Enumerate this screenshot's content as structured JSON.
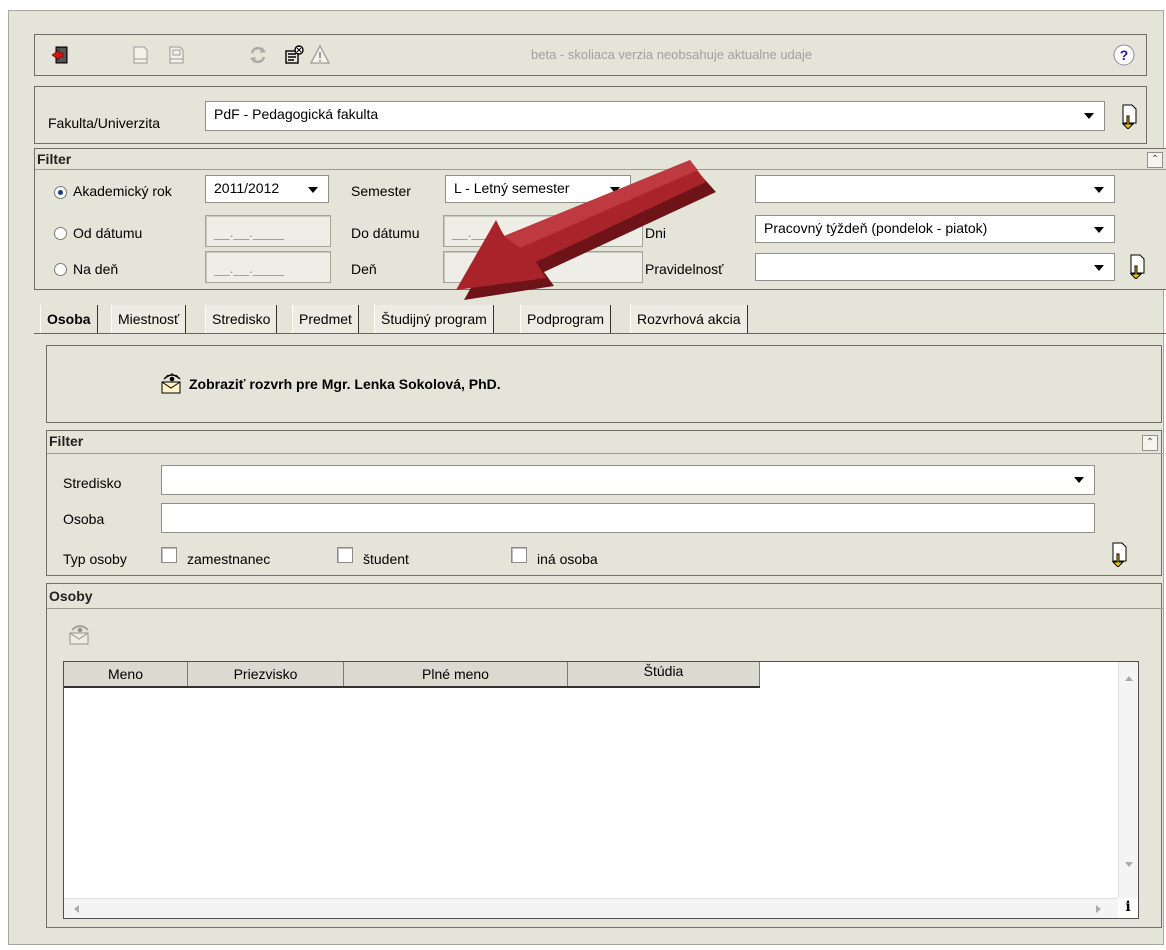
{
  "toolbar": {
    "notice": "beta - skoliaca verzia neobsahuje aktualne udaje",
    "icons": [
      "exit-icon",
      "document-icon",
      "document-export-icon",
      "refresh-icon",
      "wizard-icon",
      "warning-icon",
      "help-icon"
    ]
  },
  "faculty": {
    "label": "Fakulta/Univerzita",
    "value": "PdF - Pedagogická fakulta"
  },
  "filter": {
    "title": "Filter",
    "academic_year_label": "Akademický rok",
    "academic_year_value": "2011/2012",
    "semester_label": "Semester",
    "semester_value": "L - Letný semester",
    "from_date_label": "Od dátumu",
    "from_date_value": "__.__.____",
    "to_date_label": "Do dátumu",
    "to_date_value": "__.__.____",
    "on_day_label": "Na deň",
    "on_day_value": "__.__.____",
    "day_label": "Deň",
    "days_label": "Dni",
    "days_value": "Pracovný týždeň (pondelok - piatok)",
    "regularity_label": "Pravidelnosť"
  },
  "tabs": [
    "Osoba",
    "Miestnosť",
    "Stredisko",
    "Predmet",
    "Študijný program",
    "Podprogram",
    "Rozvrhová akcia"
  ],
  "show_schedule": "Zobraziť rozvrh pre Mgr. Lenka Sokolová, PhD.",
  "person_filter": {
    "title": "Filter",
    "center_label": "Stredisko",
    "person_label": "Osoba",
    "type_label": "Typ osoby",
    "type_employee": "zamestnanec",
    "type_student": "študent",
    "type_other": "iná osoba"
  },
  "persons": {
    "title": "Osoby",
    "columns": [
      "Meno",
      "Priezvisko",
      "Plné meno",
      "Štúdia"
    ],
    "rows": []
  },
  "colors": {
    "window_bg": "#e4e4d8",
    "arrow": "#a8232a",
    "notice_text": "#a0a0a0"
  }
}
